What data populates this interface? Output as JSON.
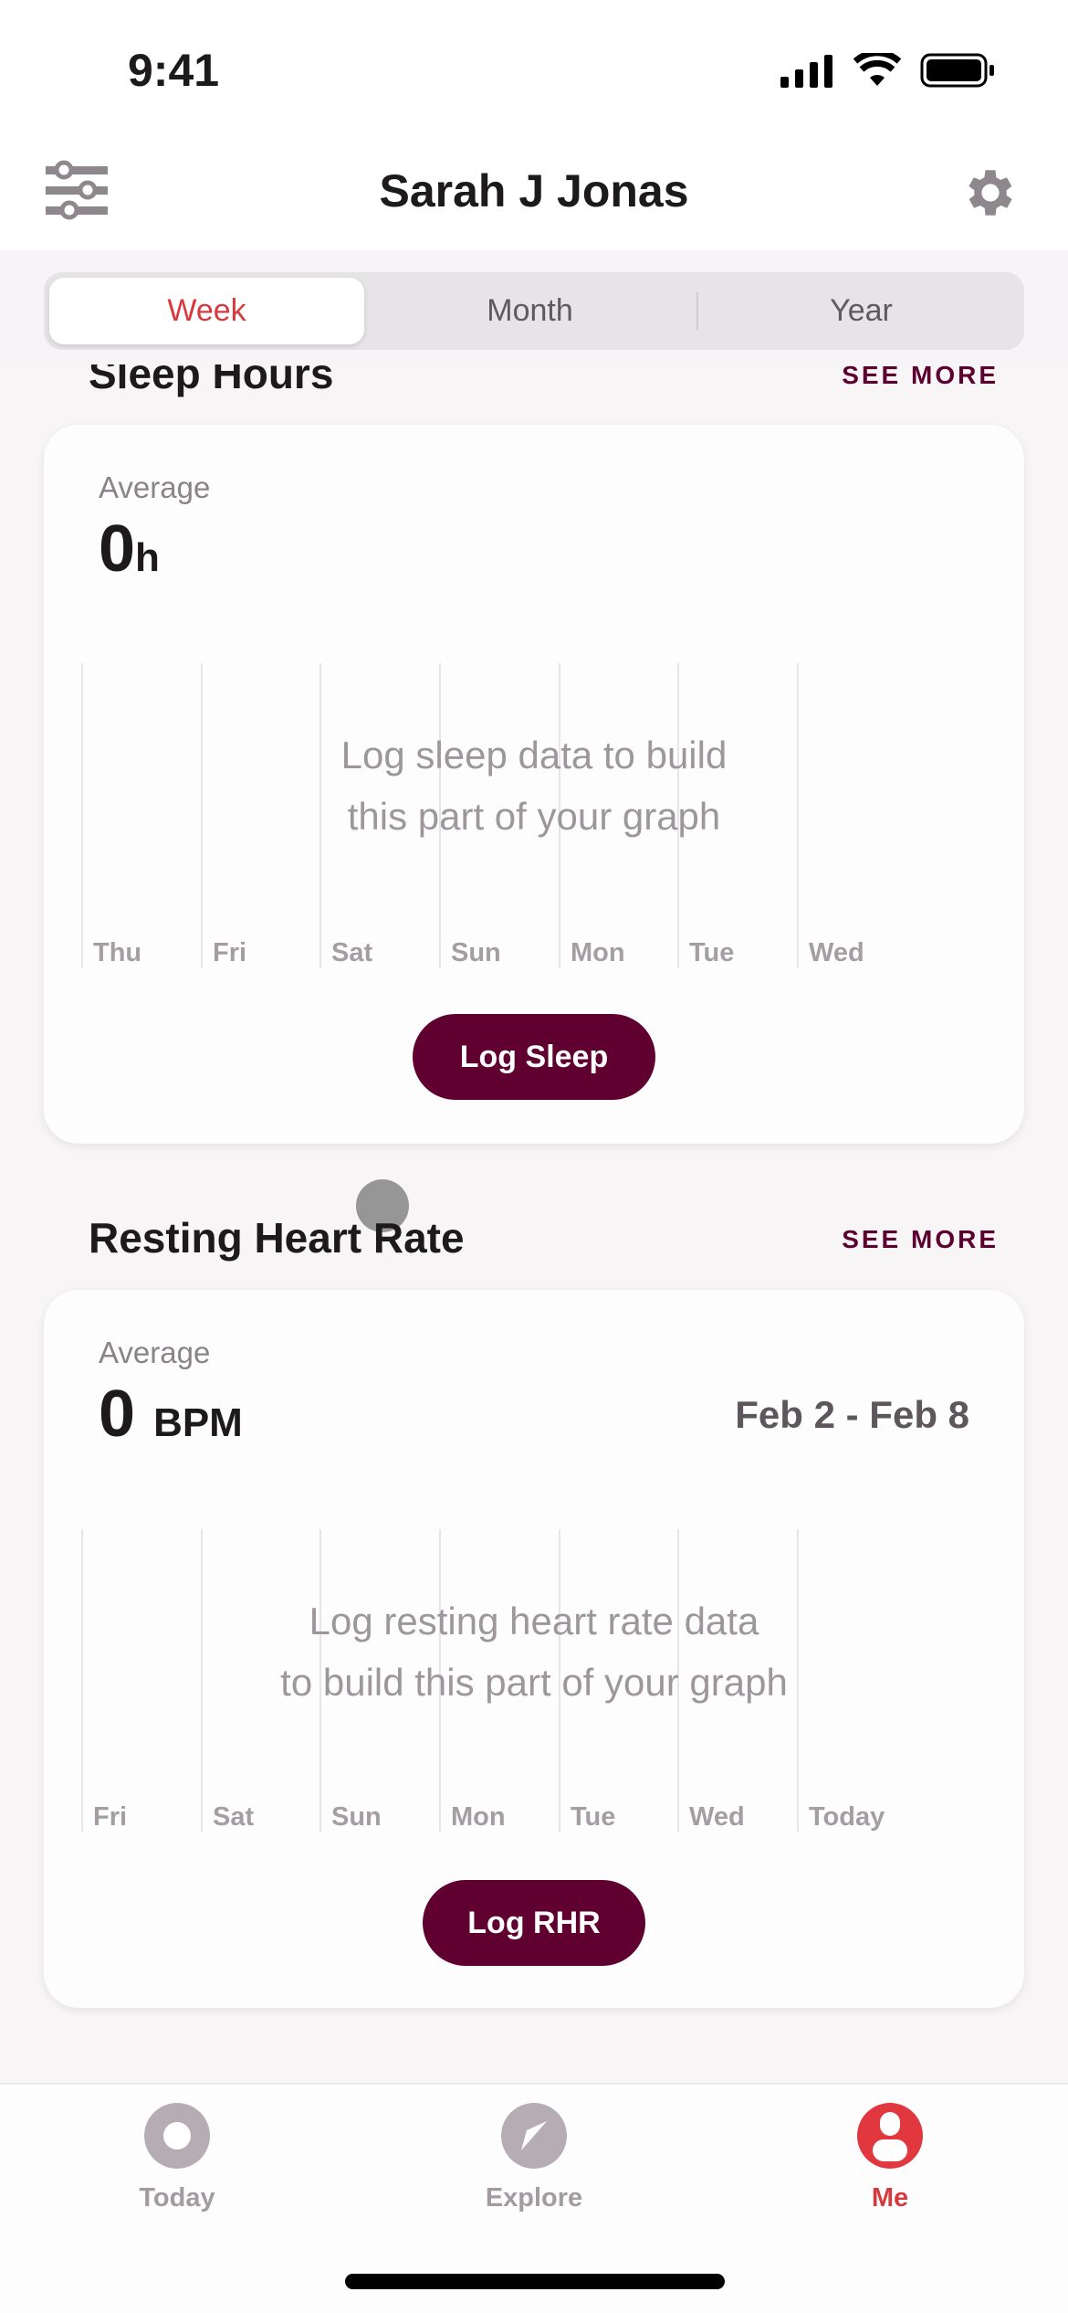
{
  "status_bar": {
    "time": "9:41"
  },
  "header": {
    "title": "Sarah J Jonas",
    "left_icon": "sliders-icon",
    "right_icon": "gear-icon"
  },
  "segments": {
    "items": [
      "Week",
      "Month",
      "Year"
    ],
    "selected": "Week"
  },
  "sleep": {
    "title": "Sleep Hours",
    "see_more": "SEE MORE",
    "average_label": "Average",
    "average_value": "0",
    "average_unit": "h",
    "days": [
      "Thu",
      "Fri",
      "Sat",
      "Sun",
      "Mon",
      "Tue",
      "Wed"
    ],
    "empty_message_1": "Log sleep data to build",
    "empty_message_2": "this part of your graph",
    "button": "Log Sleep"
  },
  "rhr": {
    "title": "Resting Heart Rate",
    "see_more": "SEE MORE",
    "average_label": "Average",
    "average_value": "0",
    "average_unit": "BPM",
    "date_range": "Feb 2 - Feb 8",
    "days": [
      "Fri",
      "Sat",
      "Sun",
      "Mon",
      "Tue",
      "Wed",
      "Today"
    ],
    "empty_message_1": "Log resting heart rate data",
    "empty_message_2": "to build this part of your graph",
    "button": "Log RHR"
  },
  "tabbar": {
    "items": [
      {
        "label": "Today",
        "icon": "ring-icon"
      },
      {
        "label": "Explore",
        "icon": "compass-icon"
      },
      {
        "label": "Me",
        "icon": "person-icon"
      }
    ],
    "active": "Me"
  },
  "colors": {
    "accent": "#d73a3e",
    "brand": "#600030",
    "inactive": "#b5adb3"
  }
}
